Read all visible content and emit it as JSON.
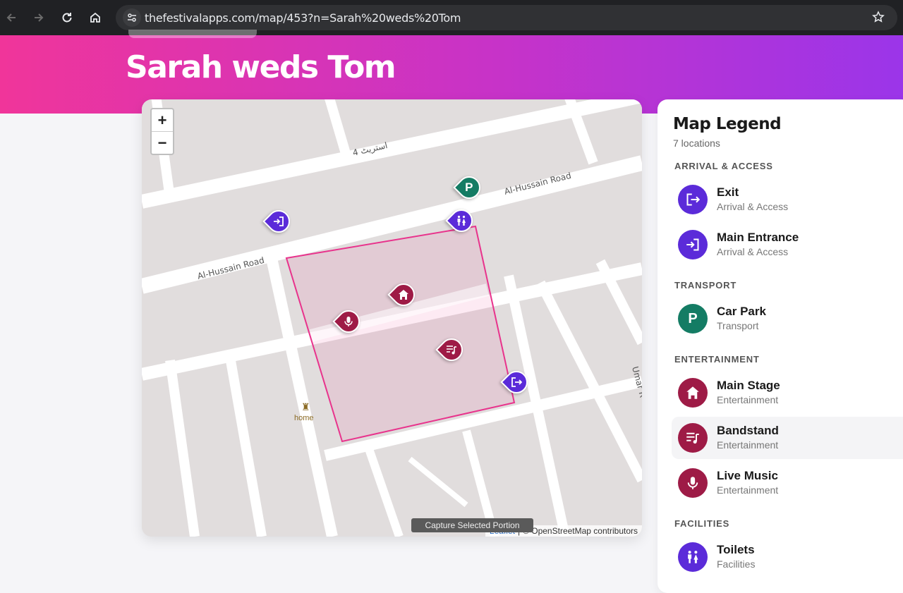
{
  "browser": {
    "url": "thefestivalapps.com/map/453?n=Sarah%20weds%20Tom"
  },
  "page": {
    "title": "Sarah weds Tom"
  },
  "map": {
    "zoom_in": "+",
    "zoom_out": "−",
    "streets": {
      "street4": "استریٹ 4",
      "road_a": "Al-Hussain Road",
      "road_b": "Al-Hussain Road",
      "umar": "Umar R"
    },
    "poi_home": "home",
    "attribution": {
      "leaflet": "Leaflet",
      "sep": "|",
      "osm": "© OpenStreetMap contributors"
    },
    "tooltip": "Capture Selected Portion",
    "parking_letter": "P",
    "colors": {
      "arrival": "#5b2bd9",
      "transport": "#147c64",
      "entertainment": "#9e1b46",
      "facilities": "#5b2bd9",
      "venue_outline": "#e8338c"
    }
  },
  "legend": {
    "title": "Map Legend",
    "count": "7 locations",
    "sections": [
      {
        "label": "ARRIVAL & ACCESS",
        "items": [
          {
            "name": "Exit",
            "category": "Arrival & Access",
            "icon": "exit-icon"
          },
          {
            "name": "Main Entrance",
            "category": "Arrival & Access",
            "icon": "entrance-icon"
          }
        ]
      },
      {
        "label": "TRANSPORT",
        "items": [
          {
            "name": "Car Park",
            "category": "Transport",
            "icon": "parking-icon",
            "letter": "P"
          }
        ]
      },
      {
        "label": "ENTERTAINMENT",
        "items": [
          {
            "name": "Main Stage",
            "category": "Entertainment",
            "icon": "stage-icon"
          },
          {
            "name": "Bandstand",
            "category": "Entertainment",
            "icon": "music-list-icon"
          },
          {
            "name": "Live Music",
            "category": "Entertainment",
            "icon": "microphone-icon"
          }
        ]
      },
      {
        "label": "FACILITIES",
        "items": [
          {
            "name": "Toilets",
            "category": "Facilities",
            "icon": "toilets-icon"
          }
        ]
      }
    ]
  }
}
